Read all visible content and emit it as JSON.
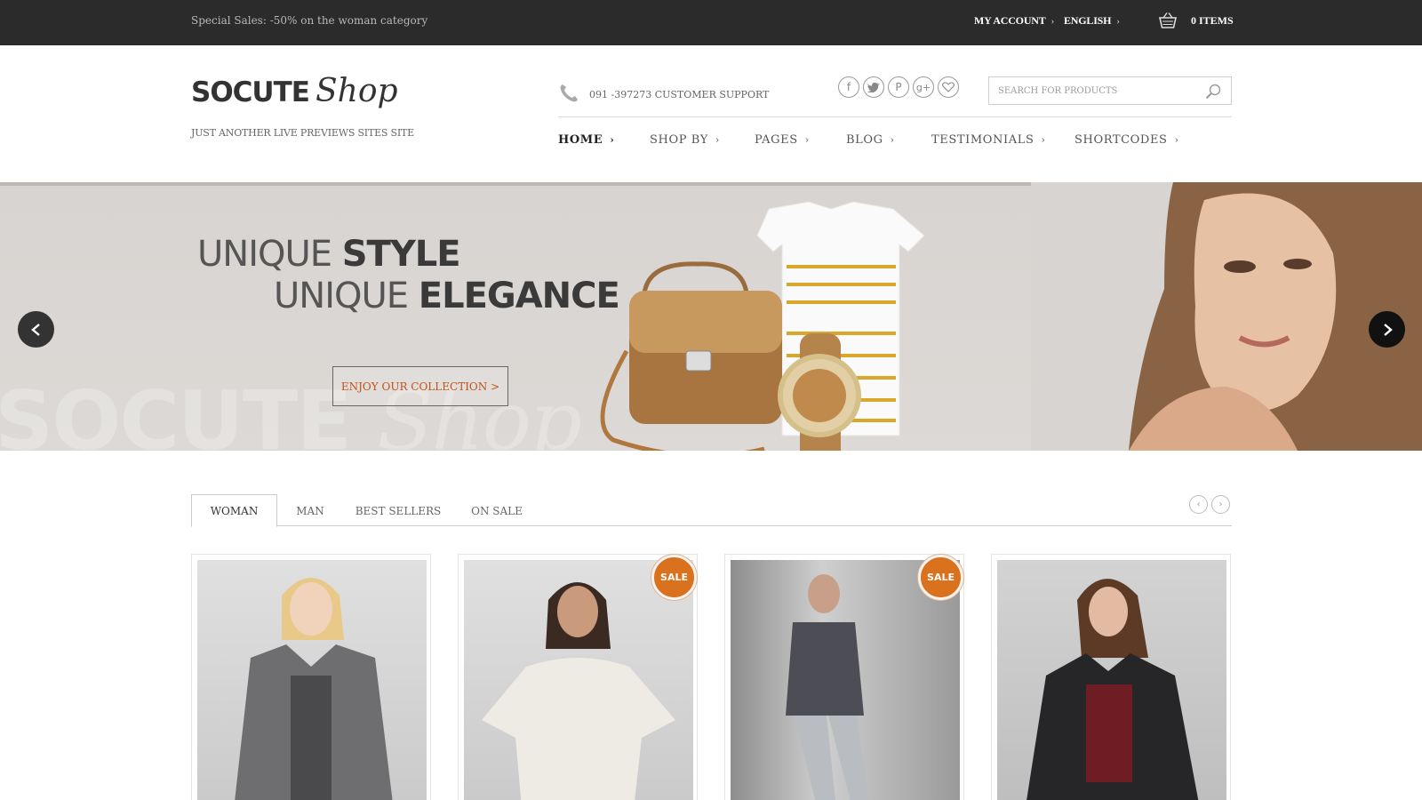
{
  "topbar": {
    "promo": "Special Sales: -50% on the woman category",
    "my_account": "MY ACCOUNT",
    "language": "ENGLISH",
    "cart_items": "0 ITEMS"
  },
  "header": {
    "brand": "SOCUTE",
    "brand_script": "Shop",
    "tagline": "JUST ANOTHER LIVE PREVIEWS SITES SITE",
    "support": "091 -397273 CUSTOMER SUPPORT",
    "search_placeholder": "SEARCH FOR PRODUCTS"
  },
  "nav": {
    "items": [
      {
        "label": "HOME"
      },
      {
        "label": "SHOP BY"
      },
      {
        "label": "PAGES"
      },
      {
        "label": "BLOG"
      },
      {
        "label": "TESTIMONIALS"
      },
      {
        "label": "SHORTCODES"
      }
    ]
  },
  "hero": {
    "line1_light": "UNIQUE ",
    "line1_bold": "STYLE",
    "line2_light": "UNIQUE ",
    "line2_bold": "ELEGANCE",
    "cta": "ENJOY OUR COLLECTION >",
    "watermark_bold": "SOCUTE",
    "watermark_script": "Shop"
  },
  "tabs": {
    "items": [
      {
        "label": "WOMAN",
        "active": true
      },
      {
        "label": "MAN",
        "active": false
      },
      {
        "label": "BEST SELLERS",
        "active": false
      },
      {
        "label": "ON SALE",
        "active": false
      }
    ]
  },
  "products": {
    "sale_label": "SALE",
    "items": [
      {
        "sale": false
      },
      {
        "sale": true
      },
      {
        "sale": true
      },
      {
        "sale": false
      }
    ]
  },
  "colors": {
    "topbar_bg": "#2b2b2b",
    "accent": "#d9711d",
    "cta_text": "#c4531a"
  }
}
